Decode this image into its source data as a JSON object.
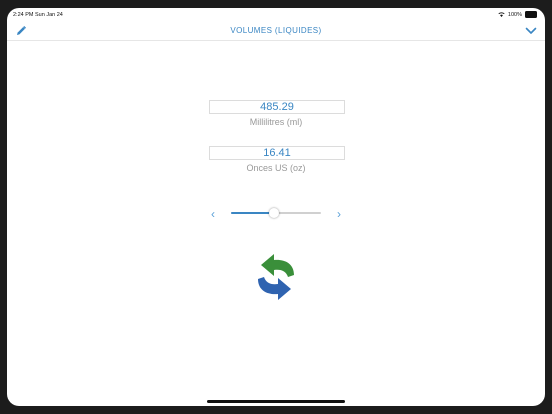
{
  "status_bar": {
    "time": "2:24 PM",
    "date": "Sun Jan 24",
    "battery": "100%"
  },
  "nav": {
    "title": "VOLUMES (LIQUIDES)",
    "left_icon": "pencil-icon",
    "right_icon": "chevron-down-icon"
  },
  "converter": {
    "top_value": "485.29",
    "top_unit": "Millilitres (ml)",
    "bottom_value": "16.41",
    "bottom_unit": "Onces US (oz)",
    "slider_level": 0.48
  },
  "colors": {
    "accent": "#3a86c3",
    "swap_green": "#3a8f3a",
    "swap_blue": "#2f63b0"
  }
}
